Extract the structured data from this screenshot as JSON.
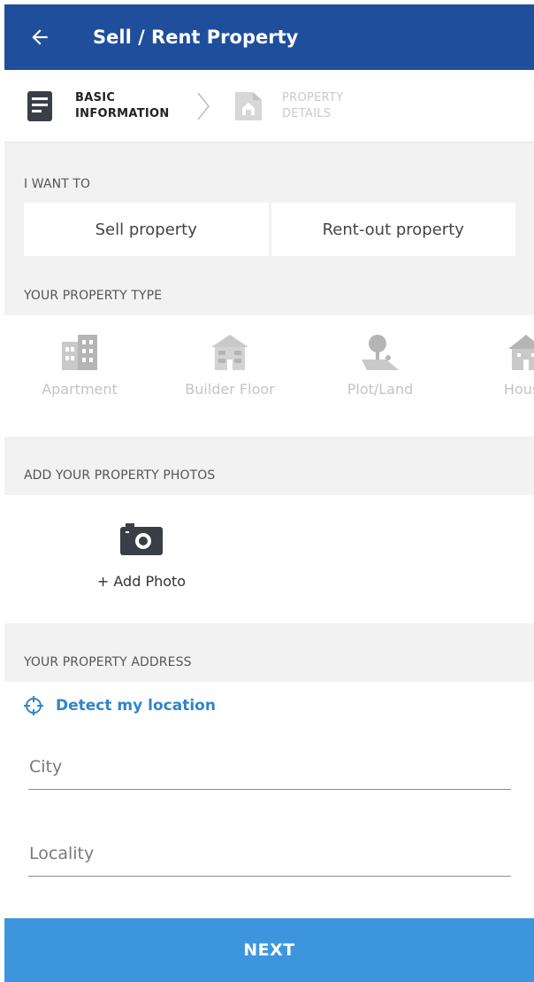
{
  "header": {
    "title": "Sell / Rent Property",
    "back_icon": "arrow-left-icon",
    "background": "#1f4f9c"
  },
  "stepper": {
    "steps": [
      {
        "label_line1": "BASIC",
        "label_line2": "INFORMATION",
        "icon": "document-icon",
        "active": true
      },
      {
        "label_line1": "PROPERTY",
        "label_line2": "DETAILS",
        "icon": "property-details-icon",
        "active": false
      }
    ],
    "separator_icon": "chevron-right-icon"
  },
  "intent": {
    "label": "I WANT TO",
    "options": [
      "Sell property",
      "Rent-out property"
    ]
  },
  "property_type": {
    "label": "YOUR PROPERTY TYPE",
    "options": [
      {
        "label": "Apartment",
        "icon": "apartment-icon"
      },
      {
        "label": "Builder Floor",
        "icon": "builder-floor-icon"
      },
      {
        "label": "Plot/Land",
        "icon": "plot-land-icon"
      },
      {
        "label": "House",
        "icon": "house-icon"
      }
    ]
  },
  "photos": {
    "label": "ADD YOUR PROPERTY PHOTOS",
    "add_label": "+ Add Photo",
    "icon": "camera-icon"
  },
  "address": {
    "label": "YOUR PROPERTY ADDRESS",
    "detect_label": "Detect my location",
    "detect_icon": "crosshair-icon",
    "city_placeholder": "City",
    "locality_placeholder": "Locality"
  },
  "footer": {
    "next_label": "NEXT",
    "accent": "#3d96dd"
  }
}
